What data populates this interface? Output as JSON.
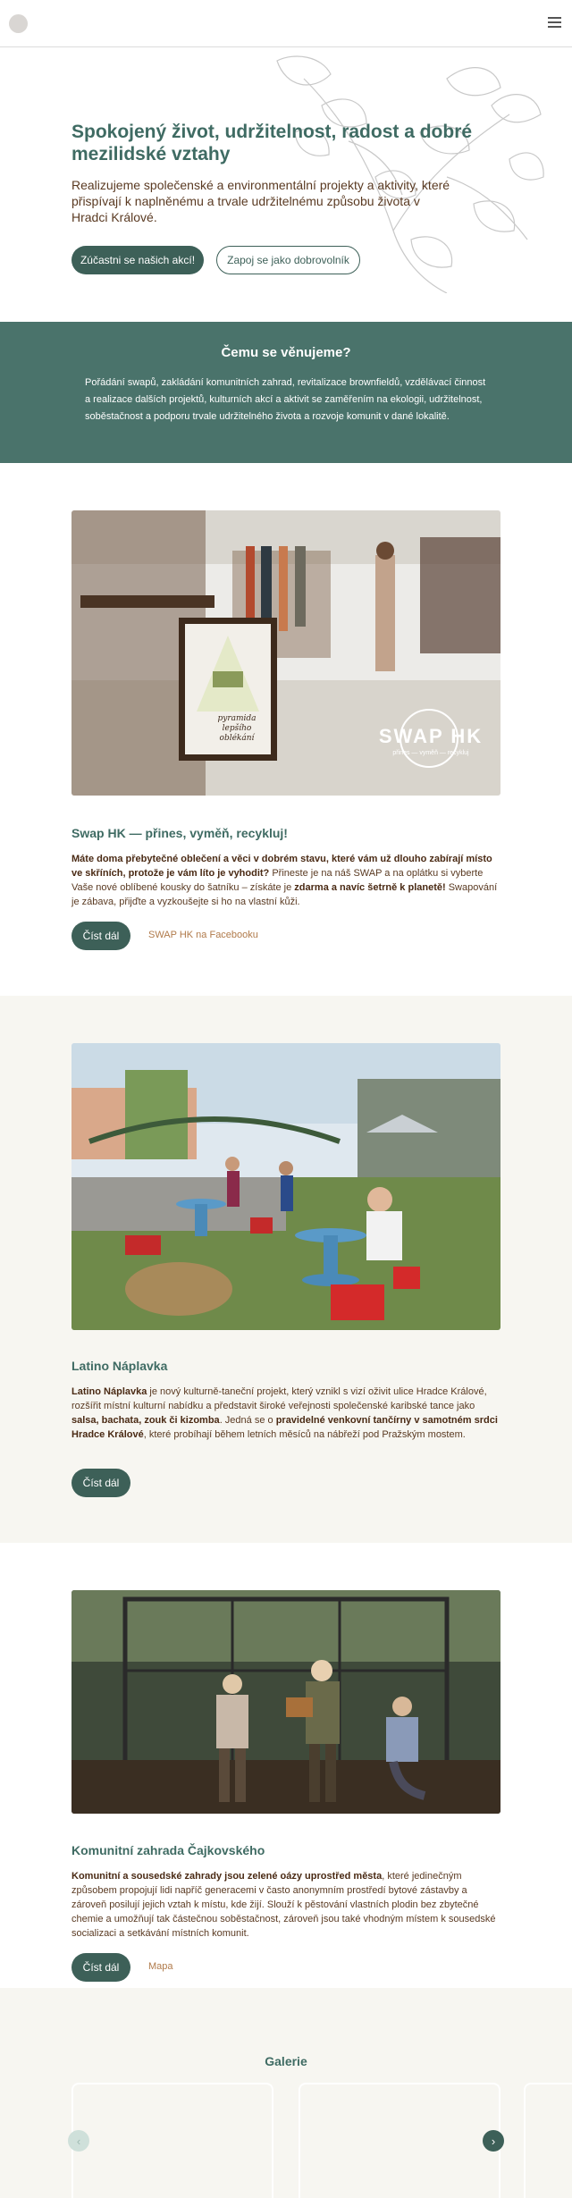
{
  "header": {
    "logo_name": "logo",
    "menu_icon": "menu-icon"
  },
  "hero": {
    "title": "Spokojený život, udržitelnost, radost a dobré mezilidské vztahy",
    "text": "Realizujeme společenské a environmentální projekty a aktivity, které přispívají k naplněnému a trvale udržitelnému způsobu života v Hradci Králové.",
    "primary_button": "Zúčastni se našich akcí!",
    "secondary_button": "Zapoj se jako dobrovolník"
  },
  "focus": {
    "title": "Čemu se věnujeme?",
    "text": "Pořádání swapů, zakládání komunitních zahrad, revitalizace brownfieldů, vzdělávací činnost a realizace dalších projektů, kulturních akcí a aktivit se zaměřením na ekologii, udržitelnost, soběstačnost a podporu trvale udržitelného života a rozvoje komunit v dané lokalitě."
  },
  "swap": {
    "title": "Swap HK — přines, vyměň, recykluj!",
    "text_bold_1": "Máte doma přebytečné oblečení a věci v dobrém stavu, které vám už dlouho zabírají místo ve skříních, protože je vám líto je vyhodit?",
    "text_1": " Přineste je na náš SWAP a na oplátku si vyberte Vaše nové oblíbené kousky do šatníku – získáte je ",
    "text_bold_2": "zdarma a navíc šetrně k planetě!",
    "text_2": " Swapování je zábava, přijďte a vyzkoušejte si ho na vlastní kůži.",
    "button": "Číst dál",
    "link": "SWAP HK na Facebooku",
    "photo_logo": "SWAP HK",
    "photo_tagline": "přines — vyměň — recykluj",
    "sign_text": "pyramida lepšího oblékání"
  },
  "naplavka": {
    "title": "Latino Náplavka",
    "text_bold_1": "Latino Náplavka",
    "text_1": " je nový kulturně-taneční projekt, který vznikl s vizí oživit ulice Hradce Králové, rozšířit místní kulturní nabídku a představit široké veřejnosti společenské karibské tance jako ",
    "text_bold_2": "salsa, bachata, zouk či kizomba",
    "text_2": ". Jedná se o ",
    "text_bold_3": "pravidelné venkovní tančírny v samotném srdci Hradce Králové",
    "text_3": ", které probíhají během letních měsíců na nábřeží pod Pražským mostem.",
    "button": "Číst dál"
  },
  "garden": {
    "title": "Komunitní zahrada Čajkovského",
    "text_bold_1": "Komunitní a sousedské zahrady jsou zelené oázy uprostřed města",
    "text_1": ", které jedinečným způsobem propojují lidi napříč generacemi v často anonymním prostředí bytové zástavby a zároveň posilují jejich vztah k místu, kde žijí. Slouží k pěstování vlastních plodin bez zbytečné chemie a umožňují tak částečnou soběstačnost, zároveň jsou také vhodným místem k sousedské socializaci a setkávání místních komunit.",
    "button": "Číst dál",
    "link": "Mapa"
  },
  "gallery": {
    "title": "Galerie",
    "prev_icon": "chevron-left-icon",
    "next_icon": "chevron-right-icon"
  },
  "colors": {
    "primary": "#3d6058",
    "band": "#4a736b",
    "heading": "#3f6b63",
    "text": "#5a3a22",
    "beige": "#f7f6f1"
  }
}
